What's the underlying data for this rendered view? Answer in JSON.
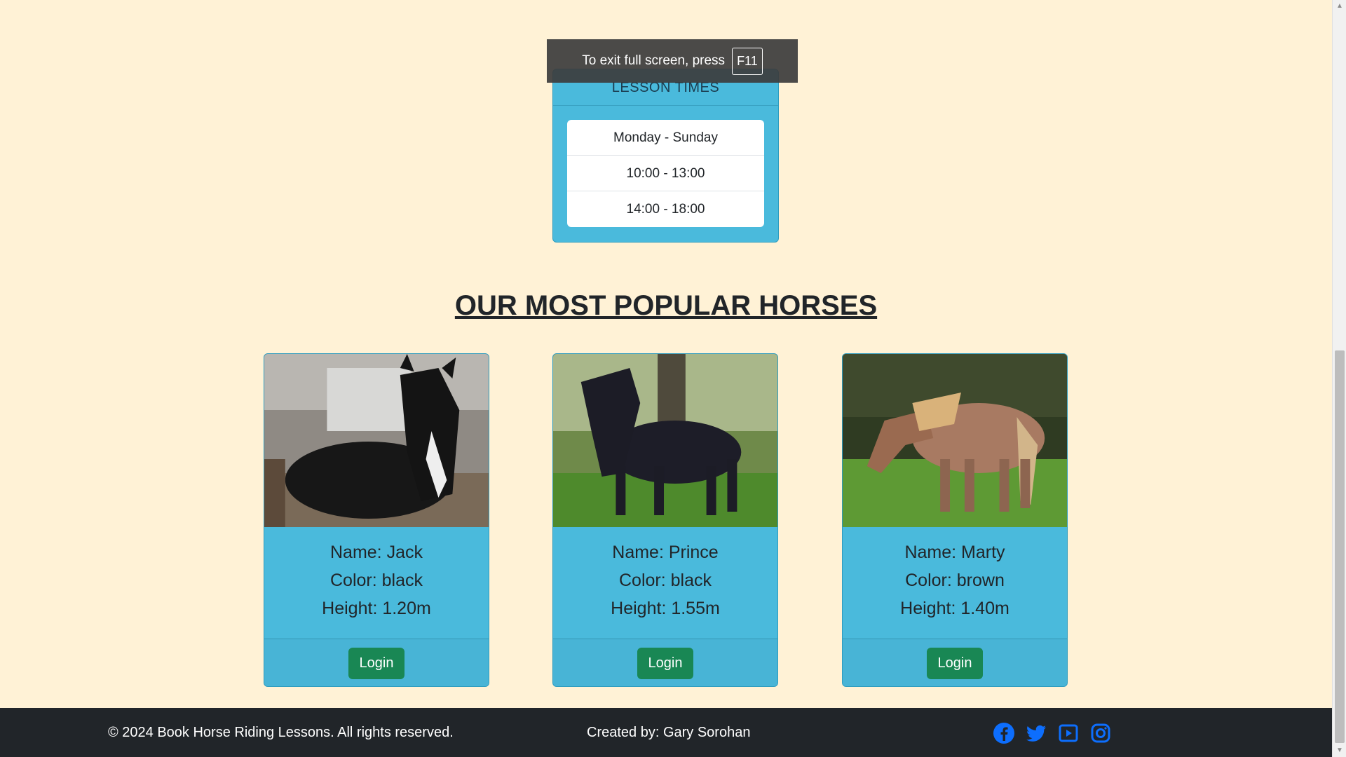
{
  "fullscreen_toast": {
    "text": "To exit full screen, press",
    "key": "F11"
  },
  "lesson_times": {
    "title": "LESSON TIMES",
    "rows": [
      "Monday - Sunday",
      "10:00 - 13:00",
      "14:00 - 18:00"
    ]
  },
  "section_title": "OUR MOST POPULAR HORSES",
  "horses": [
    {
      "name": "Name: Jack",
      "color": "Color: black",
      "height": "Height: 1.20m",
      "button": "Login",
      "coat": "#1a1a1a"
    },
    {
      "name": "Name: Prince",
      "color": "Color: black",
      "height": "Height: 1.55m",
      "button": "Login",
      "coat": "#20202c"
    },
    {
      "name": "Name: Marty",
      "color": "Color: brown",
      "height": "Height: 1.40m",
      "button": "Login",
      "coat": "#a0715a"
    }
  ],
  "footer": {
    "copyright": "© 2024 Book Horse Riding Lessons. All rights reserved.",
    "created_by": "Created by: Gary Sorohan",
    "socials": [
      "facebook-icon",
      "twitter-icon",
      "youtube-icon",
      "instagram-icon"
    ]
  },
  "colors": {
    "page_bg": "#fff2d6",
    "card_bg": "#4abadc",
    "button": "#198754",
    "footer_bg": "#212529",
    "social": "#0d6efd"
  }
}
